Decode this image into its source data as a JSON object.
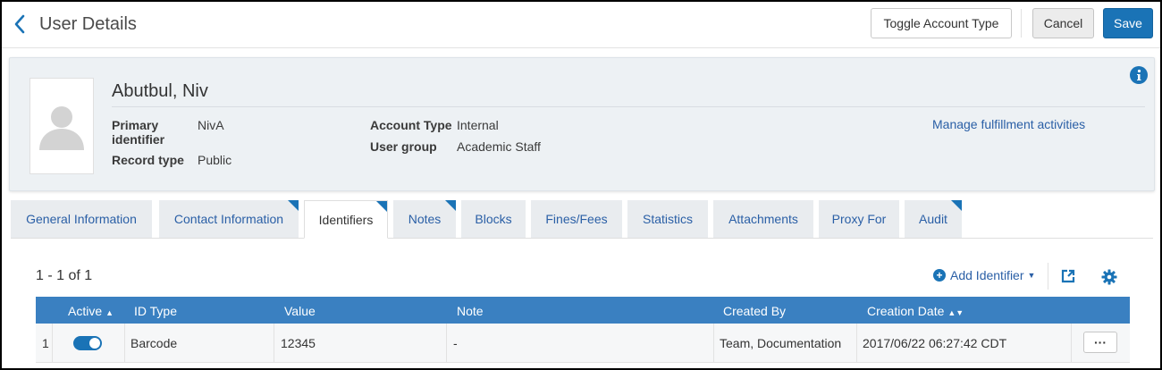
{
  "header": {
    "title": "User Details",
    "toggle_label": "Toggle Account Type",
    "cancel_label": "Cancel",
    "save_label": "Save"
  },
  "user": {
    "name": "Abutbul, Niv",
    "primary_identifier_label": "Primary identifier",
    "primary_identifier": "NivA",
    "record_type_label": "Record type",
    "record_type": "Public",
    "account_type_label": "Account Type",
    "account_type": "Internal",
    "user_group_label": "User group",
    "user_group": "Academic Staff",
    "manage_link": "Manage fulfillment activities"
  },
  "tabs": [
    {
      "label": "General Information",
      "active": false,
      "marked": false
    },
    {
      "label": "Contact Information",
      "active": false,
      "marked": true
    },
    {
      "label": "Identifiers",
      "active": true,
      "marked": true
    },
    {
      "label": "Notes",
      "active": false,
      "marked": true
    },
    {
      "label": "Blocks",
      "active": false,
      "marked": false
    },
    {
      "label": "Fines/Fees",
      "active": false,
      "marked": false
    },
    {
      "label": "Statistics",
      "active": false,
      "marked": false
    },
    {
      "label": "Attachments",
      "active": false,
      "marked": false
    },
    {
      "label": "Proxy For",
      "active": false,
      "marked": false
    },
    {
      "label": "Audit",
      "active": false,
      "marked": true
    }
  ],
  "grid": {
    "count": "1 - 1 of 1",
    "add_label": "Add Identifier",
    "columns": [
      "Active",
      "ID Type",
      "Value",
      "Note",
      "Created By",
      "Creation Date"
    ],
    "rows": [
      {
        "index": "1",
        "active": true,
        "id_type": "Barcode",
        "value": "12345",
        "note": "-",
        "created_by": "Team, Documentation",
        "creation_date": "2017/06/22 06:27:42 CDT",
        "actions": "···"
      }
    ]
  },
  "icons": {
    "back": "chevron-left-icon",
    "info": "info-icon",
    "add": "plus-circle-icon",
    "export": "export-icon",
    "settings": "gear-icon"
  },
  "colors": {
    "primary": "#1a73b6",
    "link": "#2a5fa6",
    "table_header": "#3a80c1",
    "card_bg": "#edf1f4"
  }
}
